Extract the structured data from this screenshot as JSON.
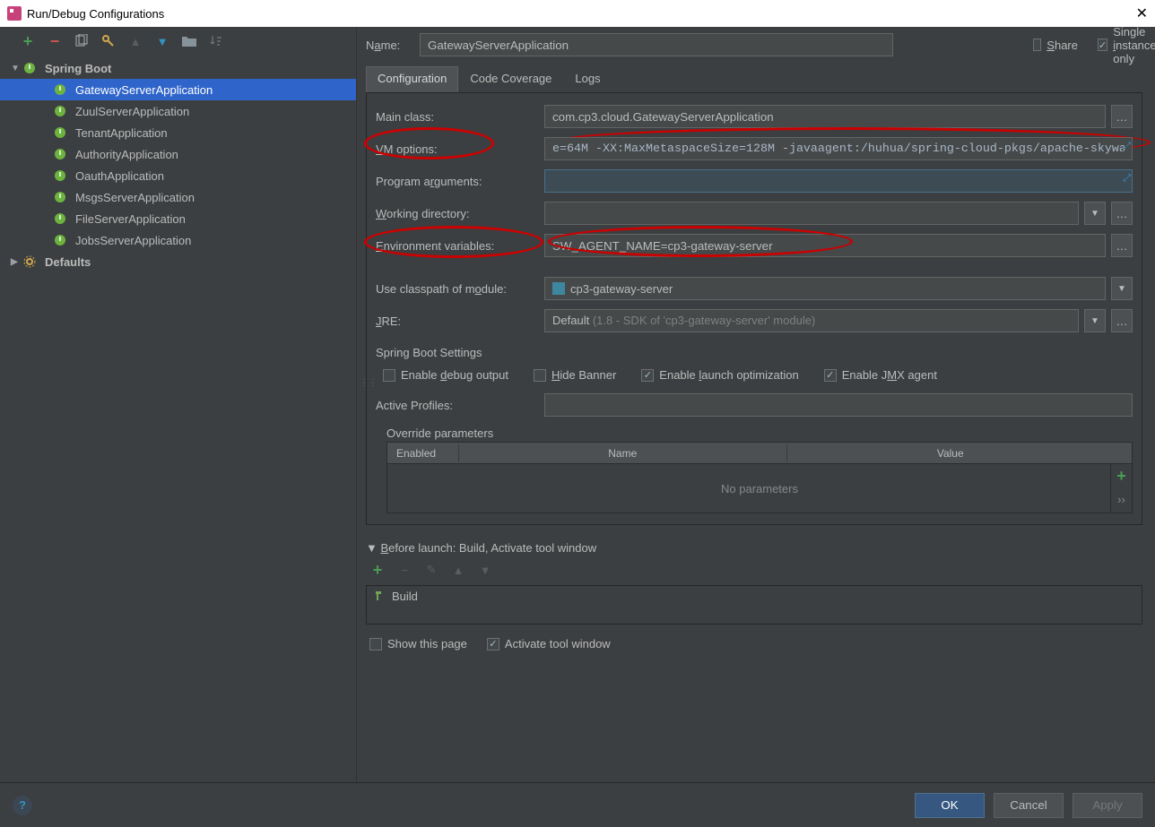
{
  "window": {
    "title": "Run/Debug Configurations"
  },
  "sidebar": {
    "root": {
      "label": "Spring Boot"
    },
    "items": [
      {
        "label": "GatewayServerApplication"
      },
      {
        "label": "ZuulServerApplication"
      },
      {
        "label": "TenantApplication"
      },
      {
        "label": "AuthorityApplication"
      },
      {
        "label": "OauthApplication"
      },
      {
        "label": "MsgsServerApplication"
      },
      {
        "label": "FileServerApplication"
      },
      {
        "label": "JobsServerApplication"
      }
    ],
    "defaults": "Defaults"
  },
  "header": {
    "name_label_pre": "N",
    "name_label_u": "a",
    "name_label_post": "me:",
    "name_value": "GatewayServerApplication",
    "share_u": "S",
    "share_post": "hare",
    "single_pre": "Single ",
    "single_u": "i",
    "single_post": "nstance only"
  },
  "tabs": {
    "config": "Configuration",
    "coverage": "Code Coverage",
    "logs": "Logs"
  },
  "form": {
    "main_class_label": "Main class:",
    "main_class_value": "com.cp3.cloud.GatewayServerApplication",
    "vm_label_u": "V",
    "vm_label_post": "M options:",
    "vm_value": "e=64M -XX:MaxMetaspaceSize=128M -javaagent:/huhua/spring-cloud-pkgs/apache-skywa",
    "prog_args_pre": "Program a",
    "prog_args_u": "r",
    "prog_args_post": "guments:",
    "prog_args_value": "",
    "workdir_u": "W",
    "workdir_post": "orking directory:",
    "workdir_value": "",
    "env_u": "E",
    "env_post": "nvironment variables:",
    "env_value": "SW_AGENT_NAME=cp3-gateway-server",
    "classpath_pre": "Use classpath of m",
    "classpath_u": "o",
    "classpath_post": "dule:",
    "classpath_value": "cp3-gateway-server",
    "jre_u": "J",
    "jre_post": "RE:",
    "jre_value_main": "Default ",
    "jre_value_hint": "(1.8 - SDK of 'cp3-gateway-server' module)",
    "spring_section": "Spring Boot Settings",
    "enable_debug_pre": "Enable ",
    "enable_debug_u": "d",
    "enable_debug_post": "ebug output",
    "hide_banner_u": "H",
    "hide_banner_post": "ide Banner",
    "enable_launch_pre": "Enable ",
    "enable_launch_u": "l",
    "enable_launch_post": "aunch optimization",
    "enable_jmx_pre": "Enable J",
    "enable_jmx_u": "M",
    "enable_jmx_post": "X agent",
    "active_profiles": "Active Profiles:",
    "active_profiles_value": "",
    "override_label": "Override parameters",
    "override_cols": {
      "enabled": "Enabled",
      "name": "Name",
      "value": "Value"
    },
    "override_empty": "No parameters"
  },
  "before_launch": {
    "label_u": "B",
    "label_post": "efore launch: Build, Activate tool window",
    "build": "Build"
  },
  "footer_checks": {
    "show_page": "Show this page",
    "activate": "Activate tool window"
  },
  "buttons": {
    "ok": "OK",
    "cancel": "Cancel",
    "apply": "Apply"
  }
}
